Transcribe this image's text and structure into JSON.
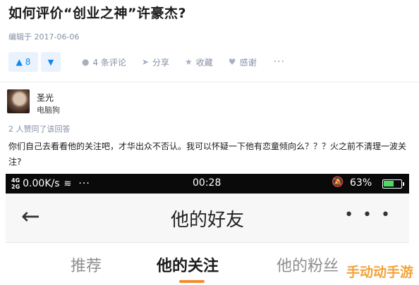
{
  "question": {
    "title": "如何评价“创业之神”许豪杰?",
    "edit_time": "编辑于 2017-06-06"
  },
  "actions": {
    "upvote_count": "8",
    "comments": "4 条评论",
    "share": "分享",
    "collect": "收藏",
    "thanks": "感谢",
    "more": "···"
  },
  "author": {
    "name": "圣光",
    "bio": "电脑狗"
  },
  "answer": {
    "agree_text": "2 人赞同了该回答",
    "text": "你们自己去看看他的关注吧，才华出众不否认。我可以怀疑一下他有恋童倾向么？？？火之前不清理一波关注?"
  },
  "phone": {
    "status_bar": {
      "signal": "4G\n2G",
      "speed": "0.00K/s",
      "dots": "···",
      "time": "00:28",
      "battery": "63%",
      "battery_level": 0.63
    },
    "nav": {
      "back_glyph": "←",
      "title": "他的好友",
      "more": "• • •"
    },
    "tabs": [
      "推荐",
      "他的关注",
      "他的粉丝"
    ],
    "active_tab": 1
  },
  "watermark": "手动动手游",
  "colors": {
    "accent": "#0f88eb",
    "tab_underline": "#f28b2c",
    "watermark": "#f2a33a"
  }
}
